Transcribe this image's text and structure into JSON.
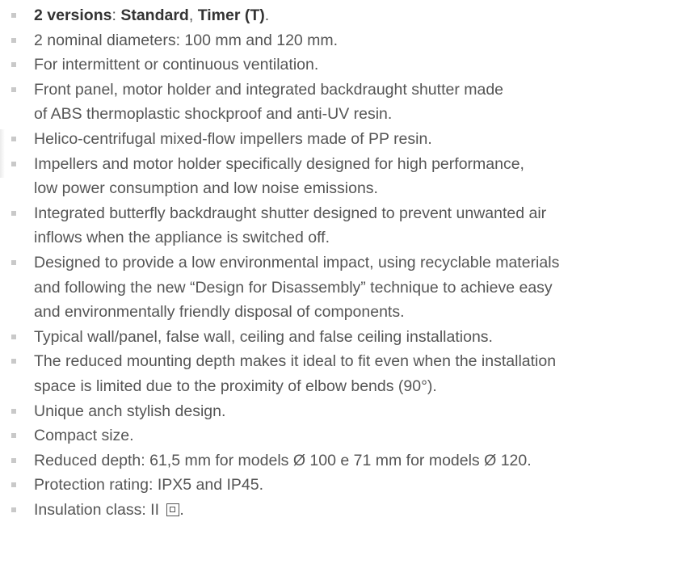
{
  "features": {
    "item1": {
      "bold_a": "2 versions",
      "sep1": ": ",
      "bold_b": "Standard",
      "sep2": ", ",
      "bold_c": "Timer (T)",
      "end": "."
    },
    "item2": "2 nominal diameters: 100 mm and 120 mm.",
    "item3": "For intermittent or continuous ventilation.",
    "item4": [
      "Front panel, motor holder and integrated backdraught shutter made",
      "of ABS thermoplastic shockproof and anti-UV resin."
    ],
    "item5": "Helico-centrifugal mixed-flow impellers made of PP resin.",
    "item6": [
      "Impellers and motor holder specifically designed for high performance,",
      "low power consumption and low noise emissions."
    ],
    "item7": [
      "Integrated butterfly backdraught shutter designed to prevent unwanted air",
      "inflows when the appliance is switched off."
    ],
    "item8": [
      "Designed to provide a low environmental impact, using recyclable materials",
      "and following the new “Design for Disassembly” technique to achieve easy",
      "and environmentally friendly disposal of components."
    ],
    "item9": "Typical wall/panel, false wall, ceiling and false ceiling installations.",
    "item10": [
      "The reduced mounting depth makes it ideal to fit even when the installation",
      "space is limited due to the proximity of elbow bends (90°)."
    ],
    "item11": "Unique anch stylish design.",
    "item12": "Compact size.",
    "item13": "Reduced depth: 61,5 mm for models Ø 100 e 71 mm for models Ø 120.",
    "item14": "Protection rating: IPX5 and IP45.",
    "item15": {
      "text": "Insulation class: II ",
      "icon": "double-insulation-icon",
      "end": "."
    }
  },
  "colors": {
    "text": "#555555",
    "bold_text": "#333333",
    "bullet": "#c9c9c9",
    "background": "#ffffff"
  }
}
